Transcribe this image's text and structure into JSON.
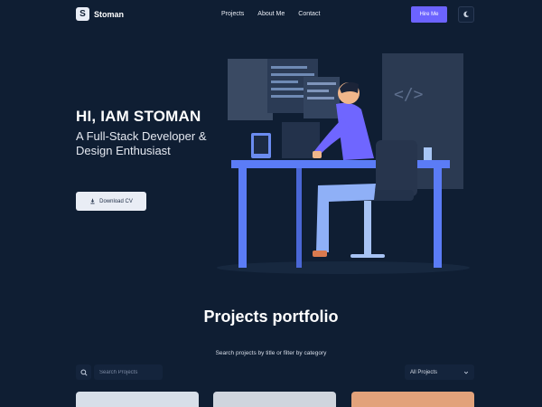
{
  "brand": {
    "logo_letter": "S",
    "name": "Stoman"
  },
  "nav": {
    "items": [
      "Projects",
      "About Me",
      "Contact"
    ]
  },
  "header": {
    "hire_label": "Hire Me",
    "theme_icon": "moon-icon"
  },
  "hero": {
    "title": "HI, IAM STOMAN",
    "subtitle": "A Full-Stack Developer & Design Enthusiast",
    "download_label": "Download CV",
    "download_icon": "download-icon",
    "illustration_code_glyph": "</>"
  },
  "projects": {
    "title": "Projects portfolio",
    "subtitle": "Search projects by title or filter by category",
    "search_placeholder": "Search Projects",
    "category_selected": "All Projects"
  },
  "colors": {
    "background": "#0f1e33",
    "accent": "#6c63ff",
    "desk": "#5b7cf6",
    "shirt": "#6f66ff",
    "pants": "#8fb0f7"
  }
}
